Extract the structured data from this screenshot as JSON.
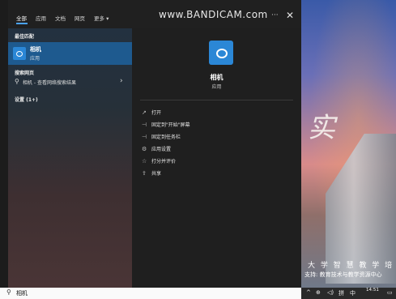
{
  "watermark": "www.BANDICAM.com",
  "tabs": [
    {
      "label": "全部"
    },
    {
      "label": "应用"
    },
    {
      "label": "文档"
    },
    {
      "label": "网页"
    },
    {
      "label": "更多 ▾"
    }
  ],
  "tab_controls": {
    "more": "···",
    "close": "✕"
  },
  "left": {
    "best_match_heading": "最佳匹配",
    "best_match": {
      "name": "相机",
      "type": "应用"
    },
    "web_heading": "搜索网页",
    "web_item": {
      "text": "相机 - 查看网络搜索结果",
      "chevron": "›"
    },
    "settings_heading": "设置 (1+)"
  },
  "right": {
    "name": "相机",
    "type": "应用",
    "actions": [
      {
        "icon": "open-icon",
        "glyph": "↗",
        "label": "打开"
      },
      {
        "icon": "pin-start-icon",
        "glyph": "⊣",
        "label": "固定到\"开始\"屏幕"
      },
      {
        "icon": "pin-taskbar-icon",
        "glyph": "⊣",
        "label": "固定到任务栏"
      },
      {
        "icon": "settings-icon",
        "glyph": "⚙",
        "label": "应用设置"
      },
      {
        "icon": "star-icon",
        "glyph": "☆",
        "label": "打分并评价"
      },
      {
        "icon": "share-icon",
        "glyph": "⇪",
        "label": "共享"
      }
    ]
  },
  "taskbar": {
    "search_query": "相机",
    "time": "14:51"
  },
  "wallpaper": {
    "calligraphy": "实",
    "caption1": "大 学 智 慧 教 学 培 训",
    "caption2": "支持: 教育技术与教学资源中心"
  },
  "tray": {
    "ime": "中",
    "lang": "拼"
  }
}
